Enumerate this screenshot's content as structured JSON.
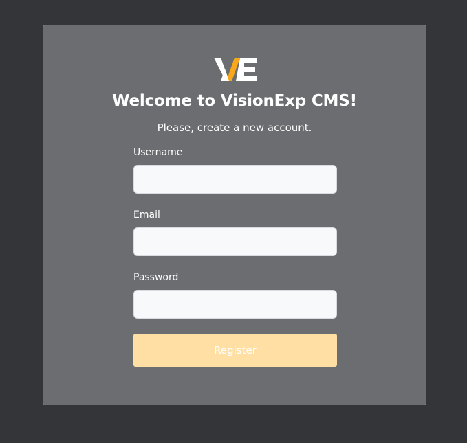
{
  "brand": {
    "logo_icon": "visionexp-logo",
    "accent_color": "#f8a91b"
  },
  "welcome": {
    "title": "Welcome to VisionExp CMS!",
    "subtitle": "Please, create a new account."
  },
  "form": {
    "username_label": "Username",
    "username_value": "",
    "email_label": "Email",
    "email_value": "",
    "password_label": "Password",
    "password_value": "",
    "register_label": "Register",
    "register_color": "#ffdfa3"
  }
}
